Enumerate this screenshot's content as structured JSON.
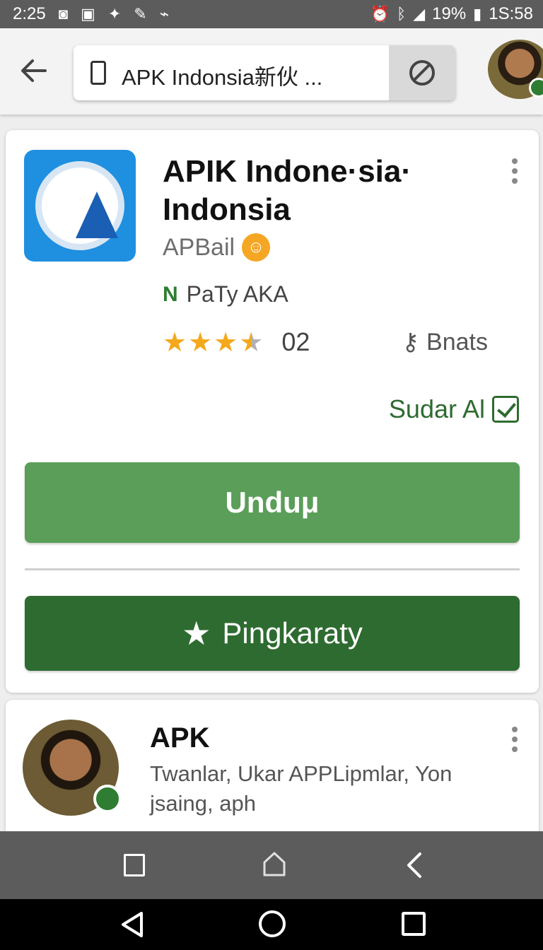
{
  "status_bar": {
    "time": "2:25",
    "battery": "19%",
    "clock_right": "1S:58"
  },
  "browser": {
    "url_text": "APK Indonsia新伙 ..."
  },
  "app_card": {
    "title": "APIK Indone·sia· Indonsia",
    "developer": "APBail",
    "publisher": "PaTy AKA",
    "rating_count": "02",
    "permission_label": "Bnats",
    "sudar_label": "Sudar Al",
    "download_label": "Unduμ",
    "rate_label": "Pingkaraty"
  },
  "second_card": {
    "title": "APK",
    "description": "Twanlar, Ukar APPLipmlar, Yon jsaing, aph"
  },
  "colors": {
    "primary_green": "#5a9e59",
    "dark_green": "#2e6b30",
    "app_icon_blue": "#1f8fe0",
    "star_gold": "#f4a81c"
  },
  "icons": {
    "back": "arrow-left-icon",
    "phone": "phone-icon",
    "block": "block-icon",
    "more": "more-vert-icon",
    "key": "key-icon",
    "check": "checkbox-icon",
    "star": "star-icon"
  }
}
